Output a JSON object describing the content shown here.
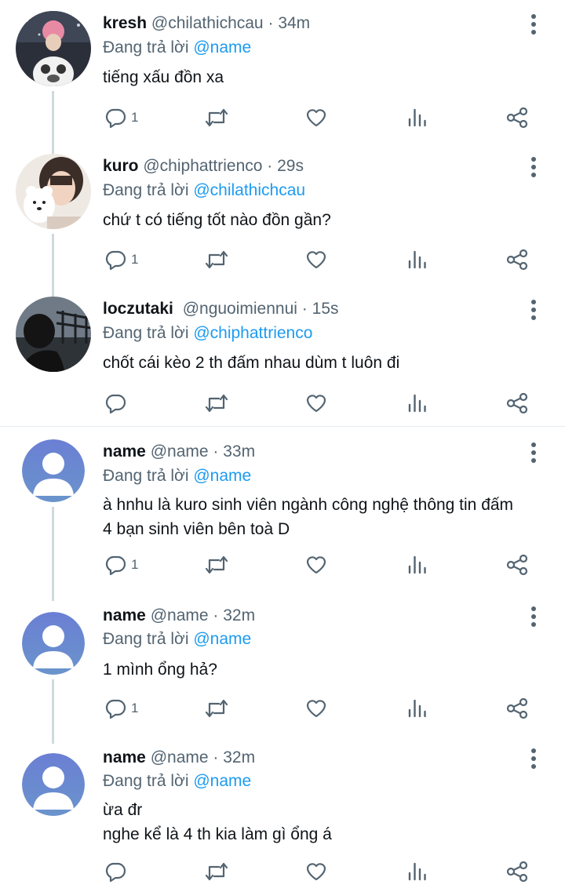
{
  "tweets": [
    {
      "name": "kresh",
      "handle": "@chilathichcau",
      "dot": "·",
      "time": "34m",
      "replying_label": "Đang trả lời",
      "replying_to": "@name",
      "text": [
        "tiếng xấu đồn xa"
      ],
      "reply_count": "1"
    },
    {
      "name": "kuro",
      "handle": "@chiphattrienco",
      "dot": "·",
      "time": "29s",
      "replying_label": "Đang trả lời",
      "replying_to": "@chilathichcau",
      "text": [
        "chứ t có tiếng tốt nào đồn gần?"
      ],
      "reply_count": "1"
    },
    {
      "name": "loczutaki",
      "handle": "@nguoimiennui",
      "dot": "·",
      "time": "15s",
      "replying_label": "Đang trả lời",
      "replying_to": "@chiphattrienco",
      "text": [
        "chốt cái kèo 2 th đấm nhau dùm t luôn đi"
      ],
      "reply_count": ""
    },
    {
      "name": "name",
      "handle": "@name",
      "dot": "·",
      "time": "33m",
      "replying_label": "Đang trả lời",
      "replying_to": "@name",
      "text": [
        "à hnhu là kuro sinh viên ngành công nghệ thông tin đấm",
        "4 bạn sinh viên bên toà D"
      ],
      "reply_count": "1"
    },
    {
      "name": "name",
      "handle": "@name",
      "dot": "·",
      "time": "32m",
      "replying_label": "Đang trả lời",
      "replying_to": "@name",
      "text": [
        "1 mình ổng hả?"
      ],
      "reply_count": "1"
    },
    {
      "name": "name",
      "handle": "@name",
      "dot": "·",
      "time": "32m",
      "replying_label": "Đang trả lời",
      "replying_to": "@name",
      "text": [
        "ừa đr",
        "nghe kể là 4 th kia làm gì ổng á"
      ],
      "reply_count": ""
    }
  ],
  "icons": {
    "reply": "reply-icon",
    "retweet": "retweet-icon",
    "like": "heart-icon",
    "analytics": "analytics-icon",
    "share": "share-icon",
    "more": "more-vertical-icon"
  },
  "colors": {
    "mention": "#1d9bf0",
    "secondary_text": "#536471",
    "primary_text": "#0f1419",
    "thread_line": "#cfd9de",
    "default_avatar": "#6a82d2"
  }
}
